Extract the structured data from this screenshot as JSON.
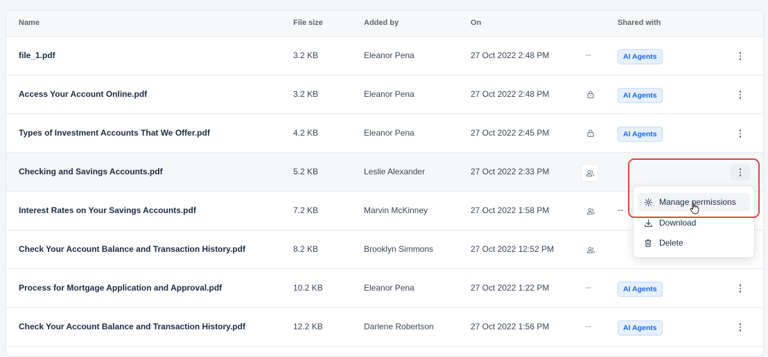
{
  "headers": {
    "name": "Name",
    "size": "File size",
    "added_by": "Added by",
    "on": "On",
    "shared": "Shared with"
  },
  "rows": [
    {
      "name": "file_1.pdf",
      "size": "3.2 KB",
      "added_by": "Eleanor Pena",
      "on": "27 Oct 2022 2:48 PM",
      "access": "none",
      "access_text": "--",
      "shared": "AI Agents"
    },
    {
      "name": "Access Your Account Online.pdf",
      "size": "3.2 KB",
      "added_by": "Eleanor Pena",
      "on": "27 Oct 2022 2:48 PM",
      "access": "lock-icon",
      "shared": "AI Agents"
    },
    {
      "name": "Types of Investment Accounts That We Offer.pdf",
      "size": "4.2 KB",
      "added_by": "Eleanor Pena",
      "on": "27 Oct 2022 2:45 PM",
      "access": "lock-icon",
      "shared": "AI Agents"
    },
    {
      "name": "Checking and Savings Accounts.pdf",
      "size": "5.2 KB",
      "added_by": "Leslie Alexander",
      "on": "27 Oct 2022 2:33 PM",
      "access": "users-icon",
      "shared": ""
    },
    {
      "name": "Interest Rates on Your Savings Accounts.pdf",
      "size": "7.2 KB",
      "added_by": "Marvin McKinney",
      "on": "27 Oct 2022 1:58 PM",
      "access": "users-icon",
      "shared_text": "--"
    },
    {
      "name": "Check Your Account Balance and Transaction History.pdf",
      "size": "8.2 KB",
      "added_by": "Brooklyn Simmons",
      "on": "27 Oct 2022 12:52 PM",
      "access": "users-icon",
      "shared": ""
    },
    {
      "name": "Process for Mortgage Application and Approval.pdf",
      "size": "10.2 KB",
      "added_by": "Eleanor Pena",
      "on": "27 Oct 2022 1:22 PM",
      "access": "none",
      "access_text": "--",
      "shared": "AI Agents"
    },
    {
      "name": "Check Your Account Balance and Transaction History.pdf",
      "size": "12.2 KB",
      "added_by": "Darlene Robertson",
      "on": "27 Oct 2022 1:56 PM",
      "access": "none",
      "access_text": "--",
      "shared": "AI Agents"
    }
  ],
  "menu": {
    "manage": "Manage permissions",
    "download": "Download",
    "delete": "Delete"
  },
  "colors": {
    "badge_bg": "#e6f0fe",
    "badge_text": "#1f66e5",
    "highlight": "#d9483b"
  }
}
